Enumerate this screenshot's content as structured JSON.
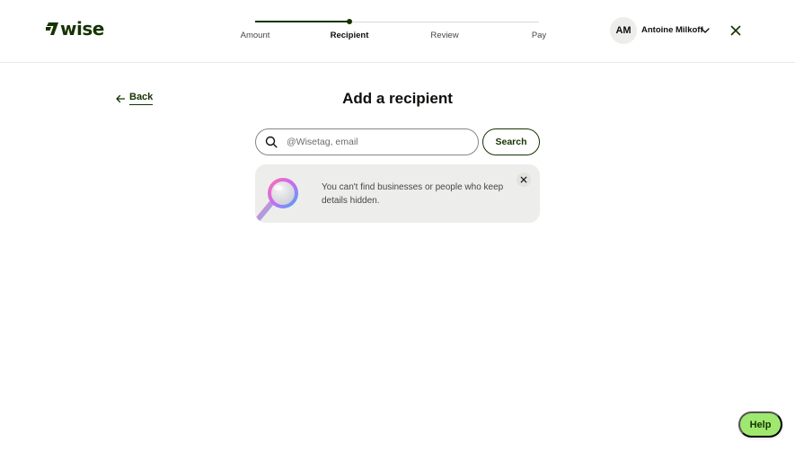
{
  "brand": {
    "name": "wise",
    "color": "#163300",
    "accent": "#9fe870"
  },
  "header": {
    "steps": [
      {
        "label": "Amount",
        "state": "done"
      },
      {
        "label": "Recipient",
        "state": "active"
      },
      {
        "label": "Review",
        "state": "todo"
      },
      {
        "label": "Pay",
        "state": "todo"
      }
    ],
    "user": {
      "initials": "AM",
      "name": "Antoine Milkoff"
    },
    "icons": {
      "chevron": "chevron-down-icon",
      "close": "close-icon"
    }
  },
  "main": {
    "back_label": "Back",
    "title": "Add a recipient",
    "search": {
      "placeholder": "@Wisetag, email",
      "value": "",
      "button_label": "Search"
    },
    "info_card": {
      "text": "You can't find businesses or people who keep details hidden.",
      "illustration": "magnifying-glass-illustration"
    }
  },
  "help_label": "Help"
}
